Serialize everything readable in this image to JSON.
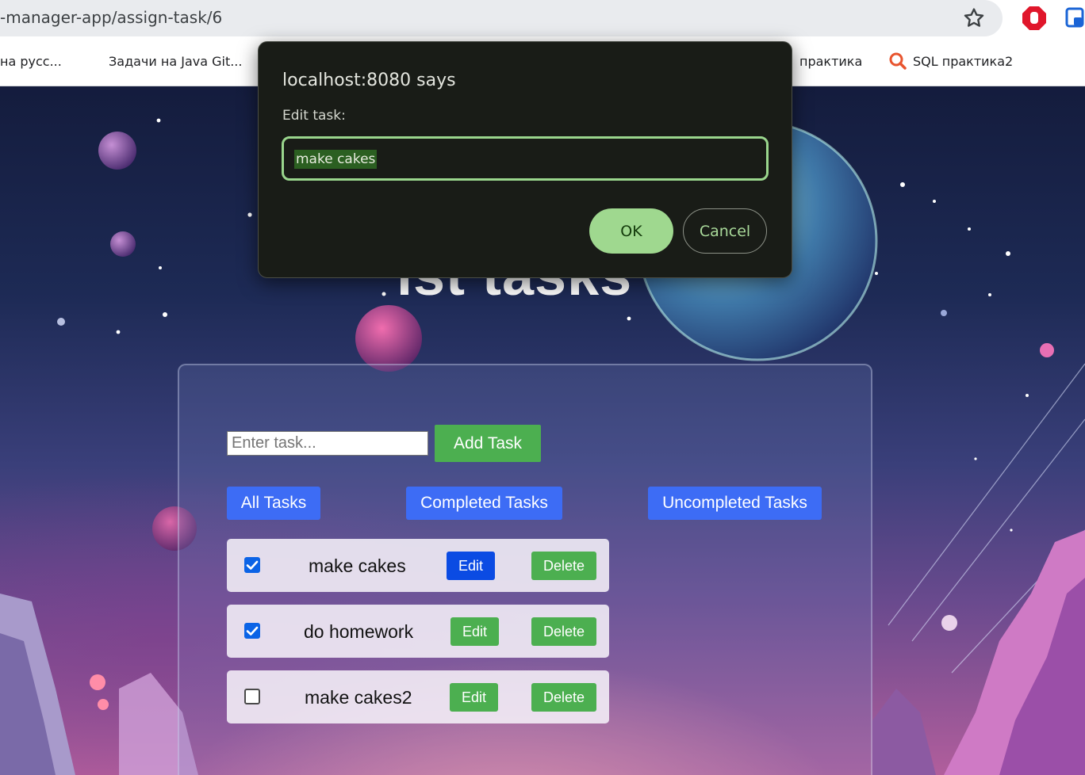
{
  "browser": {
    "url": "-manager-app/assign-task/6",
    "bookmarks": [
      "на русс...",
      "Задачи на Java Git...",
      "практика",
      "SQL практика2"
    ]
  },
  "page": {
    "heading": "ist tasks",
    "input_placeholder": "Enter task...",
    "add_button": "Add Task",
    "filters": {
      "all": "All Tasks",
      "completed": "Completed Tasks",
      "uncompleted": "Uncompleted Tasks"
    },
    "tasks": [
      {
        "text": "make cakes",
        "completed": true,
        "edit_label": "Edit",
        "delete_label": "Delete"
      },
      {
        "text": "do homework",
        "completed": true,
        "edit_label": "Edit",
        "delete_label": "Delete"
      },
      {
        "text": "make cakes2",
        "completed": false,
        "edit_label": "Edit",
        "delete_label": "Delete"
      }
    ]
  },
  "dialog": {
    "title": "localhost:8080 says",
    "label": "Edit task:",
    "value": "make cakes",
    "ok_label": "OK",
    "cancel_label": "Cancel"
  },
  "colors": {
    "green_button": "#4caf50",
    "blue_button": "#3d6cf5",
    "active_edit_button": "#0b4be3",
    "dialog_accent": "#9fd88f"
  }
}
